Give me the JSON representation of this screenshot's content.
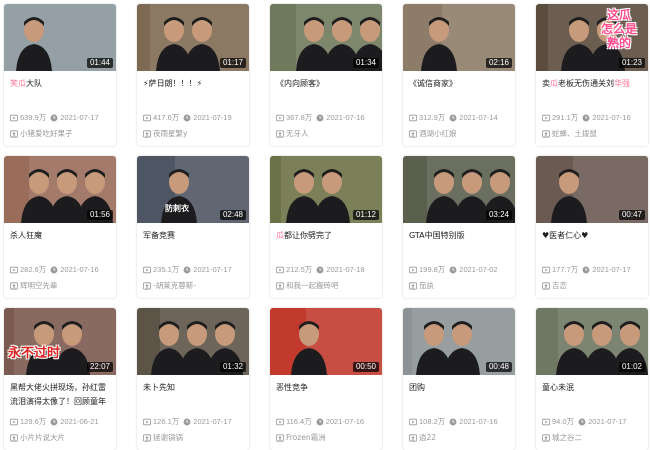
{
  "videos": [
    {
      "title_parts": [
        {
          "text": "笑瓜",
          "hl": true
        },
        {
          "text": "大队",
          "hl": false
        }
      ],
      "duration": "01:44",
      "views": "639.9万",
      "date": "2021-07-17",
      "uploader": "小猪爱吃好果子",
      "thumb_color": "#8a969c"
    },
    {
      "title_parts": [
        {
          "text": "⚡萨日朗！！！⚡",
          "hl": false
        }
      ],
      "duration": "01:17",
      "views": "417.6万",
      "date": "2021-07-19",
      "uploader": "夜雨星繁y",
      "thumb_color": "#7e6a52"
    },
    {
      "title_parts": [
        {
          "text": "《内向顾客》",
          "hl": false
        }
      ],
      "duration": "01:34",
      "views": "367.8万",
      "date": "2021-07-16",
      "uploader": "无牙人",
      "thumb_color": "#6f7a5c"
    },
    {
      "title_parts": [
        {
          "text": "《诚信商家》",
          "hl": false
        }
      ],
      "duration": "02:16",
      "views": "312.9万",
      "date": "2021-07-14",
      "uploader": "酒湖小红娘",
      "thumb_color": "#8d7d68"
    },
    {
      "title_parts": [
        {
          "text": "卖",
          "hl": false
        },
        {
          "text": "瓜",
          "hl": true
        },
        {
          "text": "老板无伤通关刘",
          "hl": false
        },
        {
          "text": "华强",
          "hl": true
        }
      ],
      "duration": "01:23",
      "views": "291.1万",
      "date": "2021-07-16",
      "uploader": "蛇蜂、土拨鼠",
      "thumb_color": "#5b4c3e",
      "overlay": "这瓜\n怎么是\n熟的"
    },
    {
      "title_parts": [
        {
          "text": "杀人狂魔",
          "hl": false
        }
      ],
      "duration": "01:56",
      "views": "282.6万",
      "date": "2021-07-16",
      "uploader": "辉明空先辈",
      "thumb_color": "#9a6d5a"
    },
    {
      "title_parts": [
        {
          "text": "军备竞赛",
          "hl": false
        }
      ],
      "duration": "02:48",
      "views": "235.1万",
      "date": "2021-07-17",
      "uploader": "-胡莱克蓉斯-",
      "thumb_color": "#4e5563",
      "overlay2": "防刺衣"
    },
    {
      "title_parts": [
        {
          "text": "瓜",
          "hl": true
        },
        {
          "text": "都让你劈完了",
          "hl": false
        }
      ],
      "duration": "01:12",
      "views": "212.5万",
      "date": "2021-07-18",
      "uploader": "和我一起搬砖吧",
      "thumb_color": "#6c7247"
    },
    {
      "title_parts": [
        {
          "text": "GTA中国特别版",
          "hl": false
        }
      ],
      "duration": "03:24",
      "views": "199.8万",
      "date": "2021-07-02",
      "uploader": "茄訙",
      "thumb_color": "#5a5f4e"
    },
    {
      "title_parts": [
        {
          "text": "♥医者仁心♥",
          "hl": false
        }
      ],
      "duration": "00:47",
      "views": "177.7万",
      "date": "2021-07-17",
      "uploader": "吉恋",
      "thumb_color": "#6a5a52"
    },
    {
      "title_parts": [
        {
          "text": "黑帮大佬火拼现场，孙红雷流泪演得太像了！回顾童年",
          "hl": false
        }
      ],
      "duration": "22:07",
      "views": "129.6万",
      "date": "2021-06-21",
      "uploader": "小片片说大片",
      "thumb_color": "#7b5a50",
      "overlay3": "永不过时"
    },
    {
      "title_parts": [
        {
          "text": "未卜先知",
          "hl": false
        }
      ],
      "duration": "01:32",
      "views": "126.1万",
      "date": "2021-07-17",
      "uploader": "拯谢锅锅",
      "thumb_color": "#5d5448"
    },
    {
      "title_parts": [
        {
          "text": "恶性竞争",
          "hl": false
        }
      ],
      "duration": "00:50",
      "views": "116.4万",
      "date": "2021-07-16",
      "uploader": "Frozen霜洲",
      "thumb_color": "#c23a2e"
    },
    {
      "title_parts": [
        {
          "text": "团购",
          "hl": false
        }
      ],
      "duration": "00:48",
      "views": "108.2万",
      "date": "2021-07-16",
      "uploader": "逍22",
      "thumb_color": "#8c9396"
    },
    {
      "title_parts": [
        {
          "text": "童心未泯",
          "hl": false
        }
      ],
      "duration": "01:02",
      "views": "94.0万",
      "date": "2021-07-17",
      "uploader": "城之谷二",
      "thumb_color": "#6e7863"
    }
  ],
  "colors": {
    "highlight": "#fb7299",
    "meta": "#999999",
    "title": "#212121"
  },
  "icons": {
    "views": "play-count-icon",
    "uploader": "uploader-icon",
    "date": "clock-icon"
  }
}
